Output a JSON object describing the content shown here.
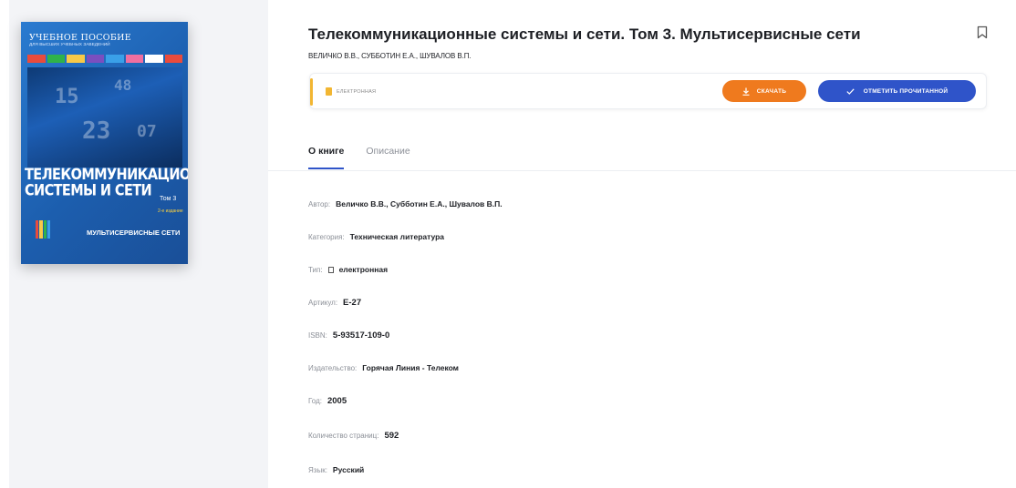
{
  "book": {
    "title": "Телекоммуникационные системы и сети. Том 3. Мультисервисные сети",
    "authors": "ВЕЛИЧКО В.В., СУББОТИН Е.А., ШУВАЛОВ В.П."
  },
  "cover": {
    "series": "УЧЕБНОЕ ПОСОБИЕ",
    "series_sub": "ДЛЯ ВЫСШИХ УЧЕБНЫХ ЗАВЕДЕНИЙ",
    "title_line1": "ТЕЛЕКОММУНИКАЦИОННЫЕ",
    "title_line2": "СИСТЕМЫ И СЕТИ",
    "volume": "Том 3",
    "edition": "2-е издание",
    "subtitle": "МУЛЬТИСЕРВИСНЫЕ СЕТИ"
  },
  "actions": {
    "type_label": "ЕЛЕКТРОННАЯ",
    "download_label": "СКАЧАТЬ",
    "mark_read_label": "ОТМЕТИТЬ ПРОЧИТАННОЙ"
  },
  "tabs": [
    {
      "label": "О книге",
      "active": true
    },
    {
      "label": "Описание",
      "active": false
    }
  ],
  "properties": {
    "author": {
      "key": "Автор:",
      "value": "Величко В.В., Субботин Е.А., Шувалов В.П."
    },
    "category": {
      "key": "Категория:",
      "value": "Техническая литература"
    },
    "type": {
      "key": "Тип:",
      "value": "електронная"
    },
    "article": {
      "key": "Артикул:",
      "value": "E-27"
    },
    "isbn": {
      "key": "ISBN:",
      "value": "5-93517-109-0"
    },
    "publisher": {
      "key": "Издательство:",
      "value": "Горячая Линия - Телеком"
    },
    "year": {
      "key": "Год:",
      "value": "2005"
    },
    "pages": {
      "key": "Количество страниц:",
      "value": "592"
    },
    "language": {
      "key": "Язык:",
      "value": "Русский"
    }
  },
  "colors": {
    "accent_orange": "#ef7a1e",
    "accent_blue": "#2f54c9",
    "type_yellow": "#f2b632"
  }
}
